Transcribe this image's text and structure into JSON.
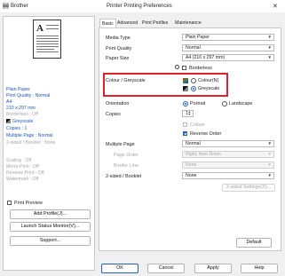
{
  "titlebar": {
    "app": "Brother",
    "title": "Printer Printing Preferences",
    "close": "✕"
  },
  "left": {
    "preview_glyph": "A",
    "info_blue": [
      "Plain Paper",
      "Print Quality : Normal",
      "A4",
      "210 x 297 mm"
    ],
    "borderless": "Borderless : Off",
    "greyscale": "Greyscale",
    "copies": "Copies : 1",
    "multiple_page": "Multiple Page : Normal",
    "twosided": "2-sided / Booklet : None",
    "gray_list": [
      "Scaling : Off",
      "Mirror Print : Off",
      "Reverse Print : Off",
      "Watermark : Off"
    ],
    "print_preview": "Print Preview",
    "add_profile": "Add Profile(J)...",
    "status_monitor": "Launch Status Monitor(V)...",
    "support": "Support..."
  },
  "tabs": [
    "Basic",
    "Advanced",
    "Print Profiles",
    "Maintenance"
  ],
  "basic": {
    "media_type_label": "Media Type",
    "media_type_value": "Plain Paper",
    "print_quality_label": "Print Quality",
    "print_quality_value": "Normal",
    "paper_size_label": "Paper Size",
    "paper_size_value": "A4 (210 x 297 mm)",
    "borderless_label": "Borderless",
    "colour_label": "Colour / Greyscale",
    "colour_opt": "Colour(N)",
    "greyscale_opt": "Greyscale",
    "orientation_label": "Orientation",
    "portrait": "Portrait",
    "landscape": "Landscape",
    "copies_label": "Copies",
    "copies_value": "1",
    "collate": "Collate",
    "reverse_order": "Reverse Order",
    "multiple_page_label": "Multiple Page",
    "multiple_page_value": "Normal",
    "page_order_label": "Page Order",
    "page_order_value": "Right, then Down",
    "border_line_label": "Border Line",
    "border_line_value": "None",
    "twosided_label": "2-sided / Booklet",
    "twosided_value": "None",
    "twosided_settings": "2-sided Settings(X)...",
    "default": "Default"
  },
  "footer": {
    "ok": "OK",
    "cancel": "Cancel",
    "apply": "Apply",
    "help": "Help"
  }
}
